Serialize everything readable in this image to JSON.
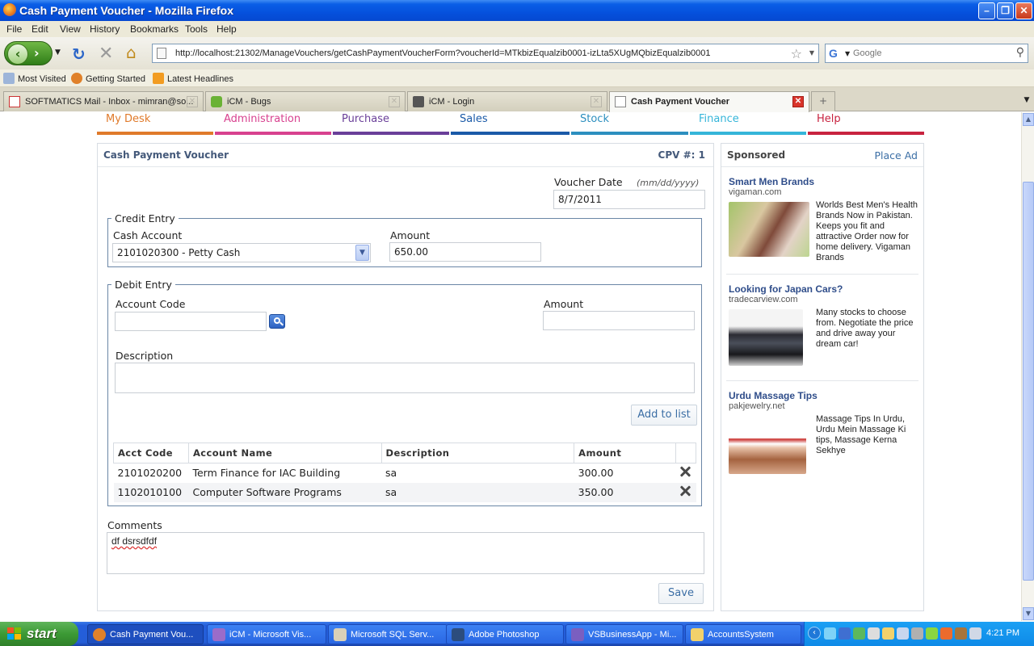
{
  "window": {
    "title": "Cash Payment Voucher - Mozilla Firefox"
  },
  "menu": [
    "File",
    "Edit",
    "View",
    "History",
    "Bookmarks",
    "Tools",
    "Help"
  ],
  "nav": {
    "url": "http://localhost:21302/ManageVouchers/getCashPaymentVoucherForm?voucherId=MTkbizEqualzib0001-izLta5XUgMQbizEqualzib0001",
    "search_placeholder": "Google"
  },
  "bookmarks": [
    "Most Visited",
    "Getting Started",
    "Latest Headlines"
  ],
  "tabs": [
    {
      "label": "SOFTMATICS Mail - Inbox - mimran@so..."
    },
    {
      "label": "iCM - Bugs"
    },
    {
      "label": "iCM - Login"
    },
    {
      "label": "Cash Payment Voucher"
    }
  ],
  "sitenav": [
    {
      "label": "My Desk",
      "color": "#e07a2a"
    },
    {
      "label": "Administration",
      "color": "#d8418f"
    },
    {
      "label": "Purchase",
      "color": "#6a3f99"
    },
    {
      "label": "Sales",
      "color": "#1a5aa8"
    },
    {
      "label": "Stock",
      "color": "#2c8fbf"
    },
    {
      "label": "Finance",
      "color": "#35b5d9"
    },
    {
      "label": "Help",
      "color": "#c8233f"
    }
  ],
  "form": {
    "title": "Cash Payment Voucher",
    "cpv_no": "CPV #: 1",
    "voucher_date_label": "Voucher Date",
    "voucher_date_hint": "(mm/dd/yyyy)",
    "voucher_date": "8/7/2011",
    "credit": {
      "legend": "Credit Entry",
      "cash_account_label": "Cash Account",
      "cash_account": "2101020300 - Petty Cash",
      "amount_label": "Amount",
      "amount": "650.00"
    },
    "debit": {
      "legend": "Debit Entry",
      "account_code_label": "Account Code",
      "account_code": "",
      "amount_label": "Amount",
      "amount": "",
      "description_label": "Description",
      "description": "",
      "add_button": "Add to list"
    },
    "grid": {
      "headers": [
        "Acct Code",
        "Account Name",
        "Description",
        "Amount"
      ],
      "rows": [
        {
          "code": "2101020200",
          "name": "Term Finance for IAC Building",
          "desc": "sa",
          "amount": "300.00"
        },
        {
          "code": "1102010100",
          "name": "Computer Software Programs",
          "desc": "sa",
          "amount": "350.00"
        }
      ]
    },
    "comments_label": "Comments",
    "comments": "df dsrsdfdf",
    "save_button": "Save"
  },
  "sponsored": {
    "title": "Sponsored",
    "place_ad": "Place Ad",
    "ads": [
      {
        "title": "Smart Men Brands",
        "source": "vigaman.com",
        "text": "Worlds Best Men's Health Brands Now in Pakistan. Keeps you fit and attractive Order now for home delivery. Vigaman Brands"
      },
      {
        "title": "Looking for Japan Cars?",
        "source": "tradecarview.com",
        "text": "Many stocks to choose from. Negotiate the price and drive away your dream car!"
      },
      {
        "title": "Urdu Massage Tips",
        "source": "pakjewelry.net",
        "text": "Massage Tips In Urdu, Urdu Mein Massage Ki tips, Massage Kerna Sekhye"
      }
    ]
  },
  "taskbar": {
    "start": "start",
    "tasks": [
      "Cash Payment Vou...",
      "iCM - Microsoft Vis...",
      "Microsoft SQL Serv...",
      "Adobe Photoshop",
      "VSBusinessApp - Mi...",
      "AccountsSystem"
    ],
    "clock": "4:21 PM"
  }
}
